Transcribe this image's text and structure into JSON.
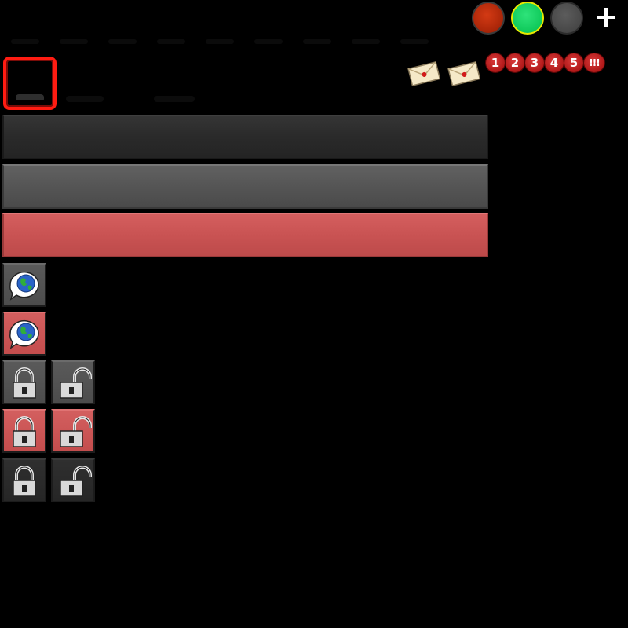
{
  "top_controls": {
    "circles": [
      {
        "name": "red",
        "color": "#a82508"
      },
      {
        "name": "green",
        "color": "#0fc95a",
        "selected_ring": "#e8e800"
      },
      {
        "name": "gray",
        "color": "#474747"
      }
    ],
    "add_icon": "plus-icon"
  },
  "notifications": {
    "letters": [
      "envelope-icon",
      "envelope-icon"
    ],
    "numbers": [
      "1",
      "2",
      "3",
      "4",
      "5",
      "!!!"
    ]
  },
  "bars": [
    {
      "name": "dark-bar",
      "color": "#2a2a2a"
    },
    {
      "name": "gray-bar",
      "color": "#555555"
    },
    {
      "name": "red-bar",
      "color": "#c95353"
    }
  ],
  "tiles": {
    "globe_chat": [
      "gray",
      "red"
    ],
    "lock_rows": [
      {
        "style": "gray",
        "icons": [
          "lock-closed-icon",
          "lock-open-icon"
        ]
      },
      {
        "style": "red",
        "icons": [
          "lock-closed-icon",
          "lock-open-icon"
        ]
      },
      {
        "style": "dark",
        "icons": [
          "lock-closed-icon",
          "lock-open-icon"
        ]
      }
    ]
  }
}
